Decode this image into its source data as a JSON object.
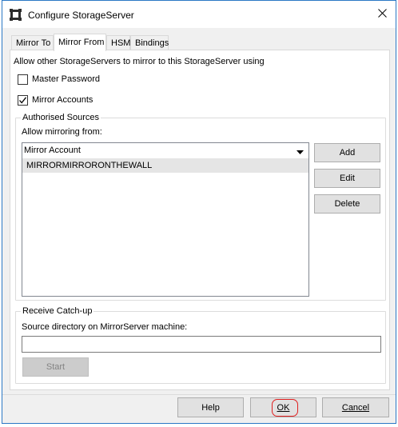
{
  "window": {
    "title": "Configure StorageServer"
  },
  "tabs": [
    {
      "label": "Mirror To"
    },
    {
      "label": "Mirror From"
    },
    {
      "label": "HSM"
    },
    {
      "label": "Bindings"
    }
  ],
  "active_tab": "Mirror From",
  "main": {
    "intro": "Allow other StorageServers to mirror to this  StorageServer using",
    "master_password": {
      "label": "Master Password",
      "checked": false
    },
    "mirror_accounts": {
      "label": "Mirror Accounts",
      "checked": true
    }
  },
  "authorised": {
    "title": "Authorised Sources",
    "allow_label": "Allow mirroring from:",
    "column_header": "Mirror Account",
    "rows": [
      "MIRRORMIRRORONTHEWALL"
    ],
    "buttons": {
      "add": "Add",
      "edit": "Edit",
      "delete": "Delete"
    }
  },
  "catchup": {
    "title": "Receive Catch-up",
    "source_label": "Source directory on MirrorServer machine:",
    "source_value": "",
    "start": "Start"
  },
  "footer": {
    "help": "Help",
    "ok": "OK",
    "cancel": "Cancel"
  },
  "colors": {
    "window_border": "#2b78c5",
    "highlight": "#e02020"
  }
}
